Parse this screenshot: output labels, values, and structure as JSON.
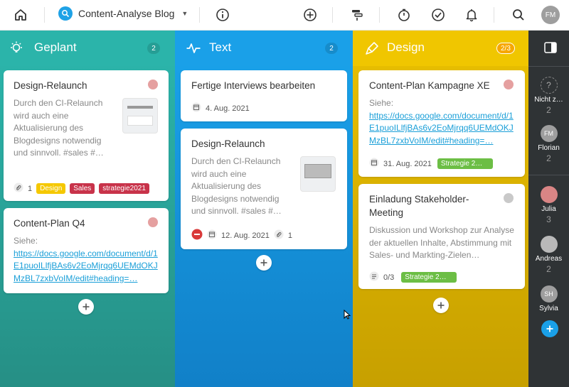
{
  "topbar": {
    "project_name": "Content-Analyse Blog",
    "user_initials": "FM"
  },
  "columns": [
    {
      "title": "Geplant",
      "count": "2",
      "color": "#2bb4aa",
      "cards": [
        {
          "title": "Design-Relaunch",
          "desc": "Durch den CI-Relaunch wird auch eine Aktualisierung des Blogdesigns notwendig und sinnvoll. #sales #…",
          "attachments": "1",
          "tags": [
            {
              "label": "Design",
              "color": "#f5c800"
            },
            {
              "label": "Sales",
              "color": "#c8334a"
            },
            {
              "label": "strategie2021",
              "color": "#c8334a"
            }
          ]
        },
        {
          "title": "Content-Plan Q4",
          "desc": "Siehe:",
          "link": "https://docs.google.com/document/d/1E1puoILlfjBAs6v2EoMjrqq6UEMdOKJMzBL7zxbVoIM/edit#heading=…"
        }
      ]
    },
    {
      "title": "Text",
      "count": "2",
      "color": "#1aa0e8",
      "cards": [
        {
          "title": "Fertige Interviews bearbeiten",
          "date": "4. Aug. 2021"
        },
        {
          "title": "Design-Relaunch",
          "desc": "Durch den CI-Relaunch wird auch eine Aktualisierung des Blogdesigns notwendig und sinnvoll. #sales #…",
          "date": "12. Aug. 2021",
          "attachments": "1"
        }
      ]
    },
    {
      "title": "Design",
      "count": "2/3",
      "color": "#f0c600",
      "cards": [
        {
          "title": "Content-Plan Kampagne XE",
          "desc": "Siehe:",
          "link": "https://docs.google.com/document/d/1E1puoILlfjBAs6v2EoMjrqq6UEMdOKJMzBL7zxbVoIM/edit#heading=…",
          "date": "31. Aug. 2021",
          "tag": {
            "label": "Strategie 2…",
            "color": "#6cbe45"
          }
        },
        {
          "title": "Einladung Stakeholder-Meeting",
          "desc": "Diskussion und Workshop zur Analyse der aktuellen Inhalte, Abstimmung mit Sales- und Markting-Zielen…",
          "checklist": "0/3",
          "tag": {
            "label": "Strategie 2…",
            "color": "#6cbe45"
          }
        }
      ]
    }
  ],
  "sidebar": {
    "people": [
      {
        "name": "Nicht z…",
        "count": "2",
        "initials": "?"
      },
      {
        "name": "Florian",
        "count": "2",
        "initials": "FM"
      },
      {
        "name": "Julia",
        "count": "3",
        "initials": ""
      },
      {
        "name": "Andreas",
        "count": "2",
        "initials": ""
      },
      {
        "name": "Sylvia",
        "count": "",
        "initials": "SH"
      }
    ]
  }
}
